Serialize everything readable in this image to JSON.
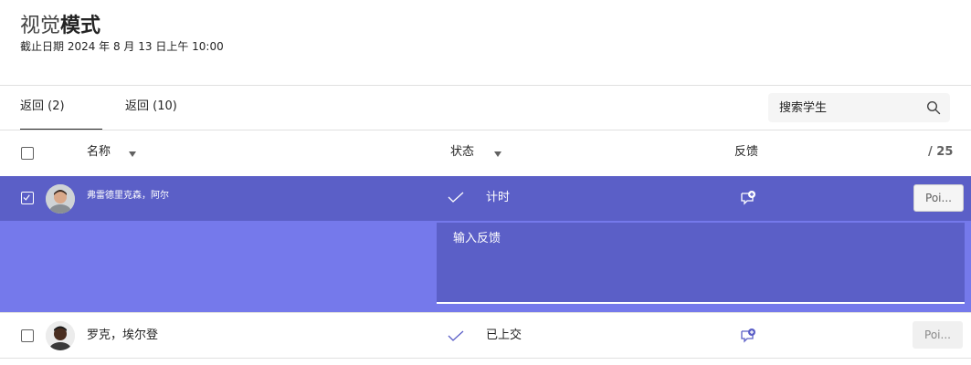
{
  "header": {
    "title_light": "视觉",
    "title_bold": "模式",
    "due_date": "截止日期 2024 年 8 月 13 日上午 10:00"
  },
  "tabs": [
    {
      "label": "返回 (2)",
      "selected": true
    },
    {
      "label": "返回 (10)",
      "selected": false
    }
  ],
  "search": {
    "placeholder": "搜索学生"
  },
  "table": {
    "columns": {
      "name": "名称",
      "status": "状态",
      "feedback": "反馈",
      "points": "/ 25"
    },
    "rows": [
      {
        "name": "弗雷德里克森，阿尔",
        "status": "计时",
        "points_placeholder": "Poi...",
        "selected": true,
        "expanded": true
      },
      {
        "name": "罗克，埃尔登",
        "status": "已上交",
        "points_placeholder": "Poi...",
        "selected": false,
        "expanded": false
      }
    ]
  },
  "feedback_editor": {
    "placeholder": "输入反馈"
  },
  "colors": {
    "accent": "#5b5fc7",
    "accent_light": "#7579eb",
    "divider": "#e0e0e0",
    "text": "#242424"
  }
}
